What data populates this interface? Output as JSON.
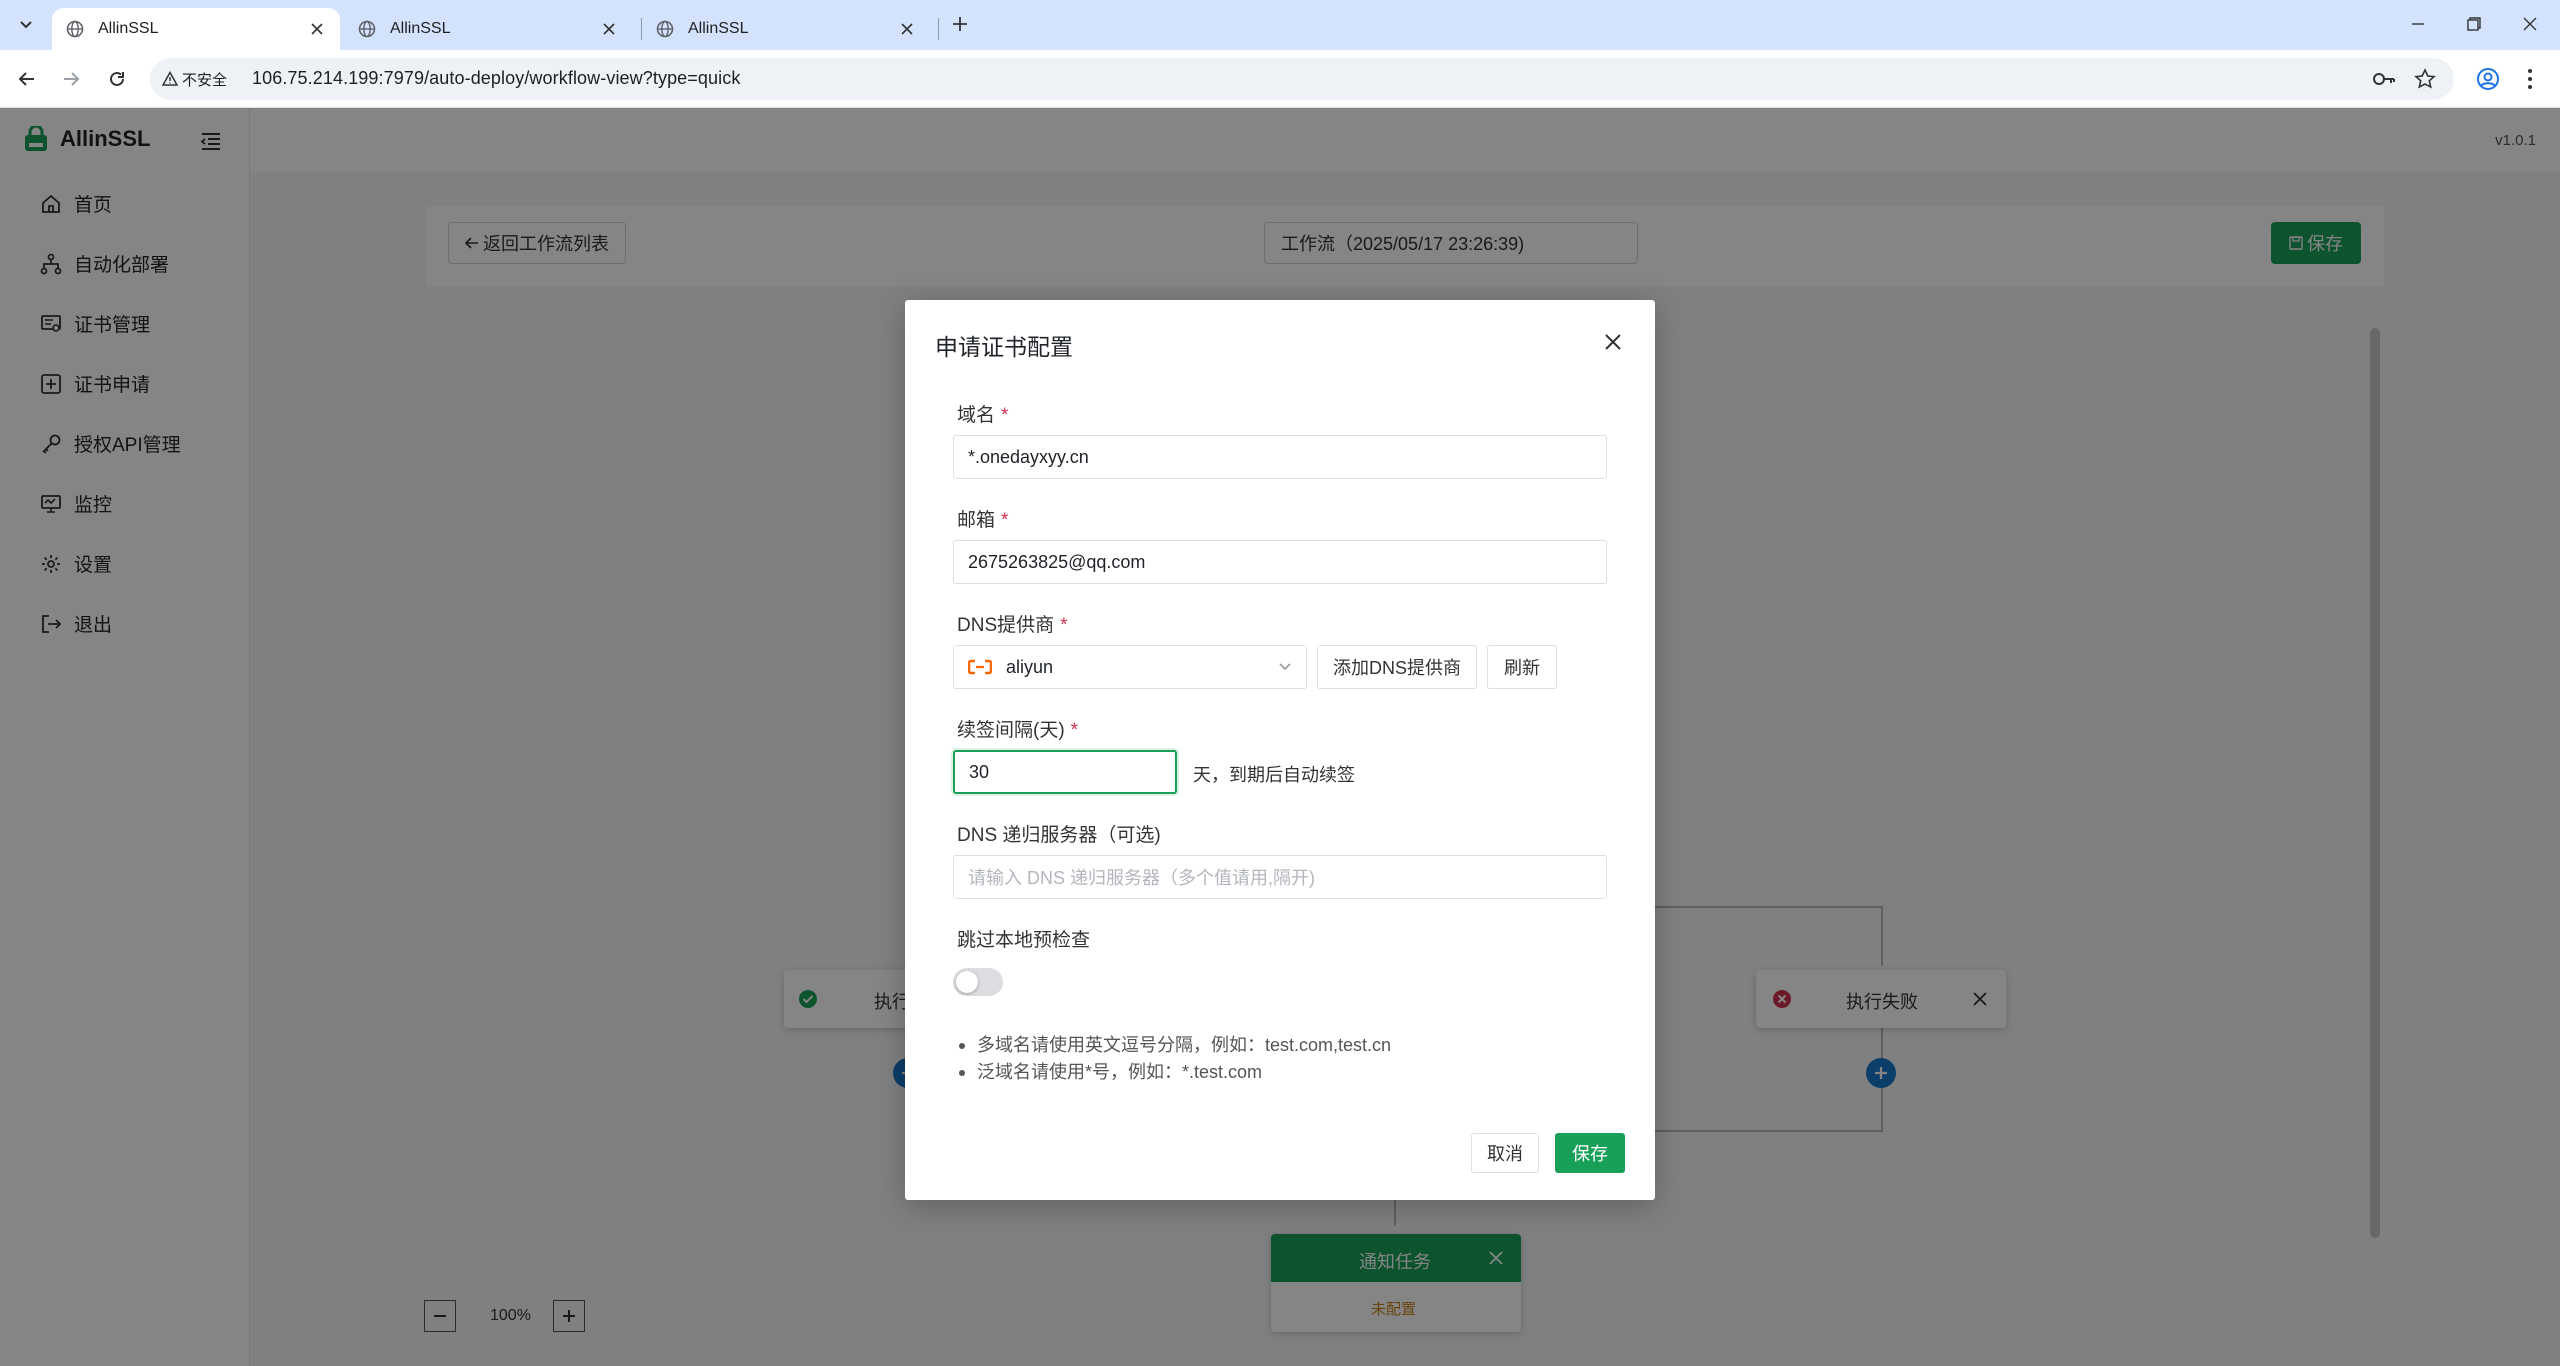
{
  "browser": {
    "tabs": [
      {
        "title": "AllinSSL"
      },
      {
        "title": "AllinSSL"
      },
      {
        "title": "AllinSSL"
      }
    ],
    "security_label": "不安全",
    "url": "106.75.214.199:7979/auto-deploy/workflow-view?type=quick"
  },
  "app": {
    "name": "AllinSSL",
    "version": "v1.0.1",
    "sidebar": {
      "items": [
        {
          "label": "首页",
          "icon": "home-icon"
        },
        {
          "label": "自动化部署",
          "icon": "workflow-icon"
        },
        {
          "label": "证书管理",
          "icon": "certificate-icon"
        },
        {
          "label": "证书申请",
          "icon": "add-square-icon"
        },
        {
          "label": "授权API管理",
          "icon": "key-icon"
        },
        {
          "label": "监控",
          "icon": "monitor-icon"
        },
        {
          "label": "设置",
          "icon": "gear-icon"
        },
        {
          "label": "退出",
          "icon": "logout-icon"
        }
      ]
    },
    "workflow": {
      "back_label": "返回工作流列表",
      "name": "工作流（2025/05/17 23:26:39)",
      "save_label": "保存",
      "nodes": {
        "success_partial": "执行",
        "fail_label": "执行失败",
        "notify_label": "通知任务",
        "notify_status": "未配置"
      },
      "zoom": "100%"
    }
  },
  "modal": {
    "title": "申请证书配置",
    "fields": {
      "domain": {
        "label": "域名",
        "required": "*",
        "value": "*.onedayxyy.cn"
      },
      "email": {
        "label": "邮箱",
        "required": "*",
        "value": "2675263825@qq.com"
      },
      "dns": {
        "label": "DNS提供商",
        "required": "*",
        "value": "aliyun",
        "add_label": "添加DNS提供商",
        "refresh_label": "刷新"
      },
      "renew": {
        "label": "续签间隔(天)",
        "required": "*",
        "value": "30",
        "suffix": "天，到期后自动续签"
      },
      "dns_server": {
        "label": "DNS 递归服务器（可选)",
        "placeholder": "请输入 DNS 递归服务器（多个值请用,隔开)"
      },
      "skip_check": {
        "label": "跳过本地预检查",
        "enabled": false
      }
    },
    "tips": [
      "多域名请使用英文逗号分隔，例如：test.com,test.cn",
      "泛域名请使用*号，例如：*.test.com"
    ],
    "cancel_label": "取消",
    "save_label": "保存"
  },
  "colors": {
    "accent": "#18a058",
    "danger": "#d03050",
    "node_blue": "#1677c9"
  }
}
